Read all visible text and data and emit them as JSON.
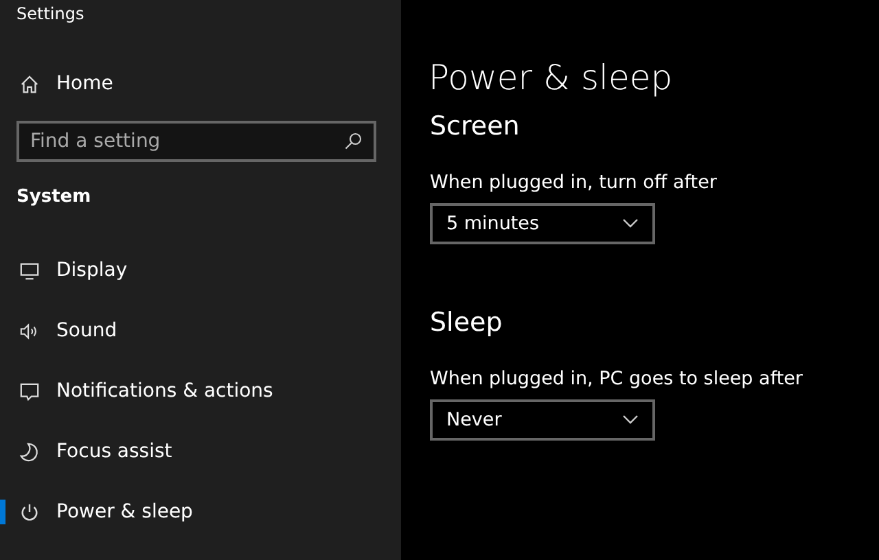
{
  "window": {
    "title": "Settings"
  },
  "sidebar": {
    "home": "Home",
    "search": {
      "placeholder": "Find a setting"
    },
    "section": "System",
    "items": [
      {
        "label": "Display",
        "selected": false
      },
      {
        "label": "Sound",
        "selected": false
      },
      {
        "label": "Notifications & actions",
        "selected": false
      },
      {
        "label": "Focus assist",
        "selected": false
      },
      {
        "label": "Power & sleep",
        "selected": true
      }
    ]
  },
  "page": {
    "title": "Power & sleep",
    "groups": [
      {
        "heading": "Screen",
        "label": "When plugged in, turn off after",
        "value": "5 minutes"
      },
      {
        "heading": "Sleep",
        "label": "When plugged in, PC goes to sleep after",
        "value": "Never"
      }
    ]
  }
}
